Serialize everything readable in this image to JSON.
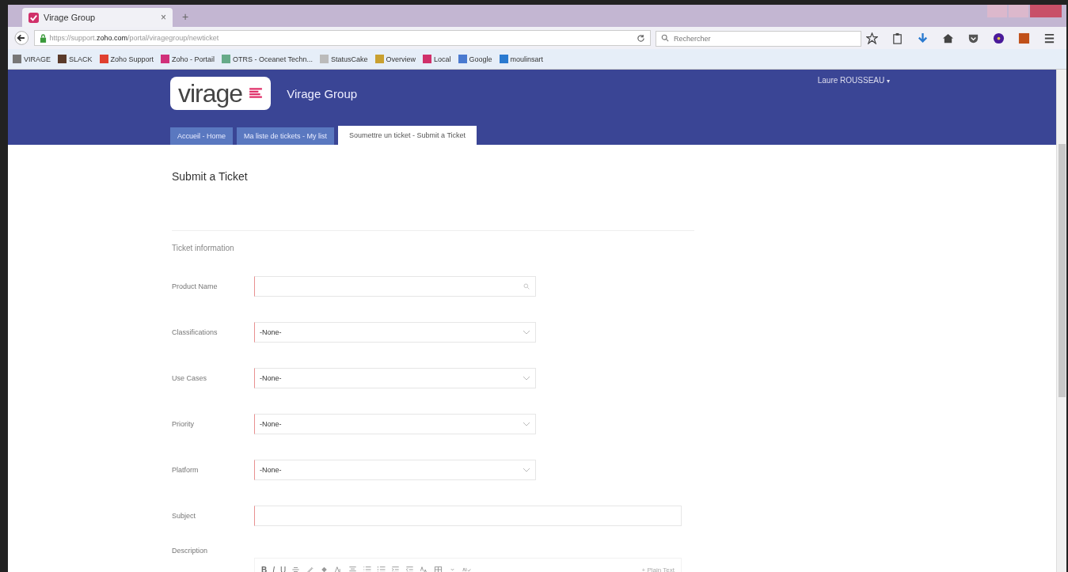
{
  "browser": {
    "tab_title": "Virage Group",
    "tab_close": "×",
    "new_tab": "+",
    "url_prefix": "https://support.",
    "url_domain": "zoho.com",
    "url_path": "/portal/viragegroup/newticket",
    "search_placeholder": "Rechercher",
    "bookmarks": [
      "VIRAGE",
      "SLACK",
      "Zoho Support",
      "Zoho - Portail",
      "OTRS - Oceanet Techn...",
      "StatusCake",
      "Overview",
      "Local",
      "Google",
      "moulinsart"
    ]
  },
  "header": {
    "logo": "virage",
    "brand": "Virage Group",
    "user": "Laure ROUSSEAU",
    "user_caret": "▾"
  },
  "tabs": [
    {
      "label": "Accueil - Home",
      "selected": false
    },
    {
      "label": "Ma liste de tickets - My list",
      "selected": false
    },
    {
      "label": "Soumettre un ticket - Submit a Ticket",
      "selected": true
    }
  ],
  "page_title": "Submit a Ticket",
  "section": "Ticket information",
  "fields": [
    {
      "label": "Product Name",
      "kind": "lookup"
    },
    {
      "label": "Classifications",
      "kind": "select",
      "value": "-None-"
    },
    {
      "label": "Use Cases",
      "kind": "select",
      "value": "-None-"
    },
    {
      "label": "Priority",
      "kind": "select",
      "value": "-None-"
    },
    {
      "label": "Platform",
      "kind": "select",
      "value": "-None-"
    },
    {
      "label": "Subject",
      "kind": "text"
    },
    {
      "label": "Description",
      "kind": "editor",
      "tools": [
        "B",
        "I",
        "U"
      ],
      "plain_text": "+ Plain Text"
    }
  ]
}
